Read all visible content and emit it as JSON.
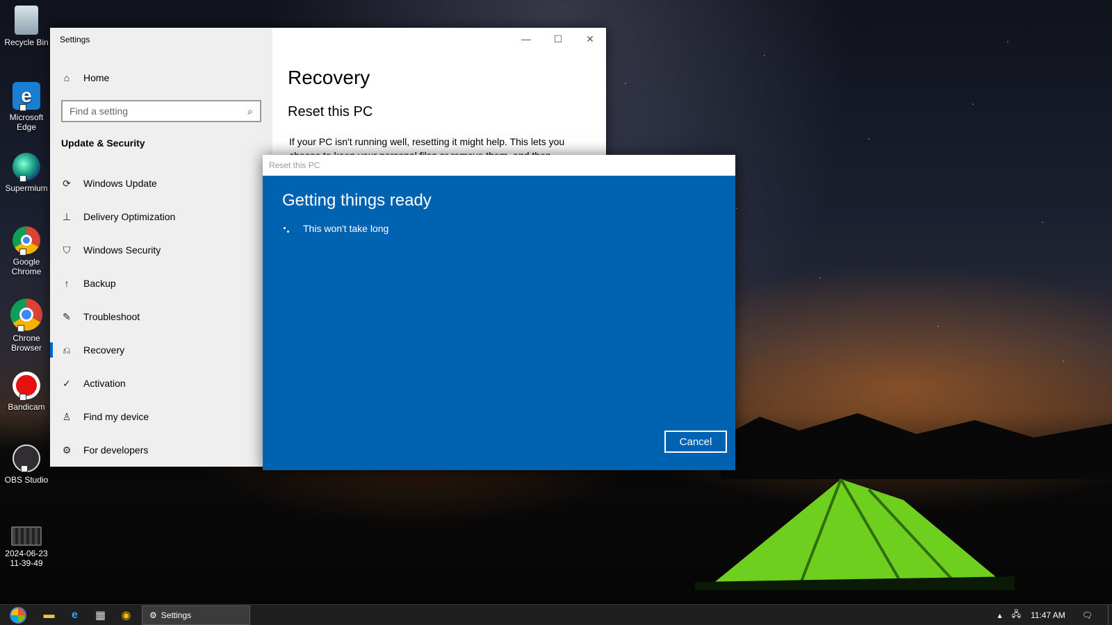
{
  "desktop": {
    "icons": [
      {
        "label": "Recycle Bin",
        "icon": "recycle-bin-icon"
      },
      {
        "label": "Microsoft Edge",
        "icon": "edge-icon"
      },
      {
        "label": "Supermium",
        "icon": "supermium-icon"
      },
      {
        "label": "Google Chrome",
        "icon": "chrome-icon"
      },
      {
        "label": "Chrone Browser",
        "icon": "chrone-browser-icon"
      },
      {
        "label": "Bandicam",
        "icon": "bandicam-icon"
      },
      {
        "label": "OBS Studio",
        "icon": "obs-icon"
      },
      {
        "label": "2024-06-23 11-39-49",
        "icon": "video-file-icon"
      }
    ]
  },
  "settings": {
    "window_title": "Settings",
    "home_label": "Home",
    "search_placeholder": "Find a setting",
    "section_title": "Update & Security",
    "nav_items": [
      {
        "label": "Windows Update",
        "icon": "sync-icon"
      },
      {
        "label": "Delivery Optimization",
        "icon": "delivery-icon"
      },
      {
        "label": "Windows Security",
        "icon": "shield-icon"
      },
      {
        "label": "Backup",
        "icon": "backup-arrow-icon"
      },
      {
        "label": "Troubleshoot",
        "icon": "wrench-icon"
      },
      {
        "label": "Recovery",
        "icon": "recovery-icon",
        "active": true
      },
      {
        "label": "Activation",
        "icon": "check-circle-icon"
      },
      {
        "label": "Find my device",
        "icon": "person-location-icon"
      },
      {
        "label": "For developers",
        "icon": "developer-tools-icon"
      }
    ],
    "page_title": "Recovery",
    "sub_title": "Reset this PC",
    "description": "If your PC isn't running well, resetting it might help. This lets you choose to keep your personal files or remove them, and then"
  },
  "dialog": {
    "title": "Reset this PC",
    "heading": "Getting things ready",
    "status": "This won't take long",
    "cancel_label": "Cancel",
    "background_color": "#0063b1"
  },
  "taskbar": {
    "task_label": "Settings",
    "clock": "11:47 AM"
  }
}
